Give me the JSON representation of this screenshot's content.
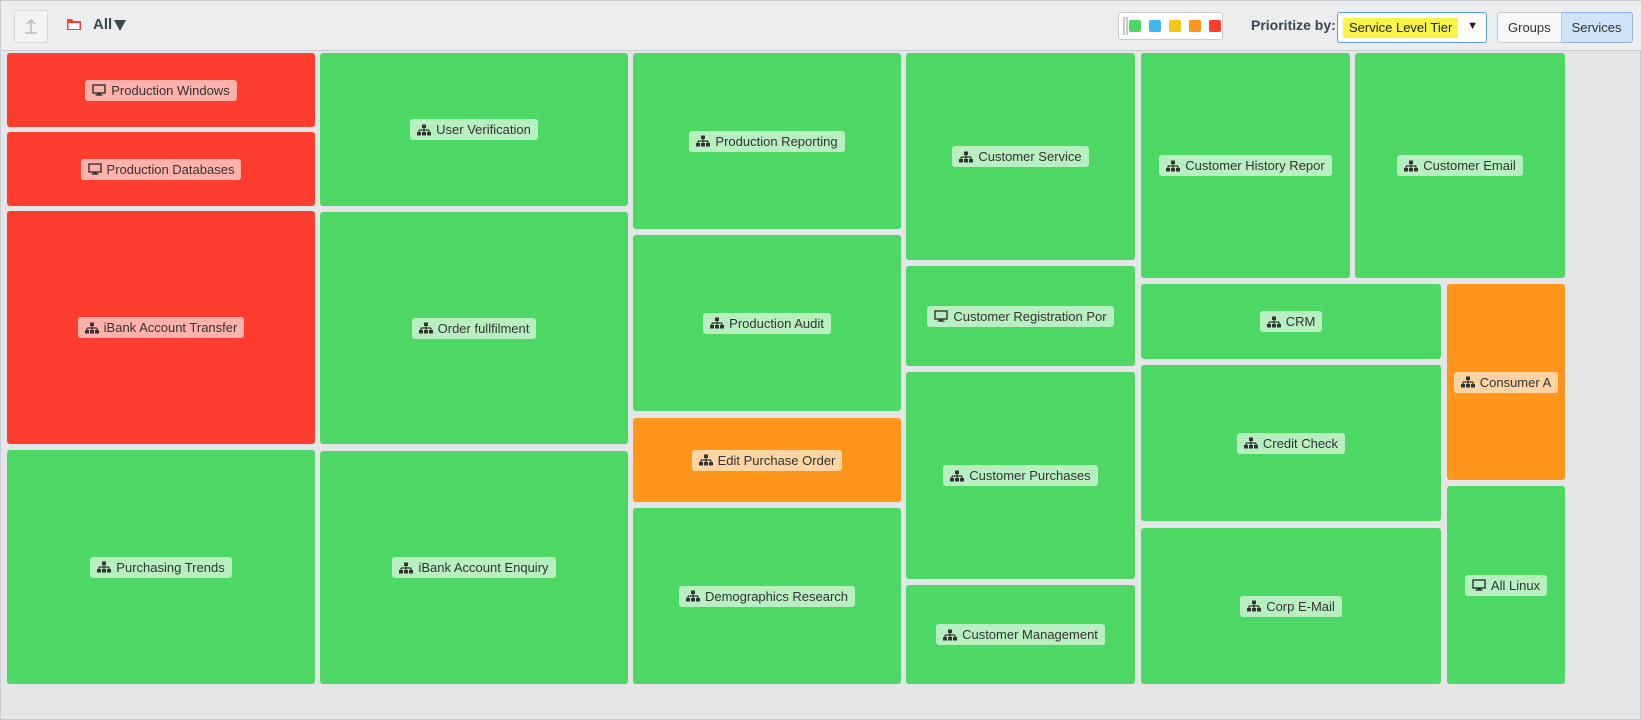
{
  "toolbar": {
    "filter_label": "All",
    "prioritize_label": "Prioritize by:",
    "prioritize_value": "Service Level Tier",
    "groups_label": "Groups",
    "services_label": "Services",
    "legend_colors": [
      "#4dd865",
      "#3fb8f0",
      "#f5c518",
      "#ff951a",
      "#ff3d2f"
    ]
  },
  "tiles": [
    {
      "label": "Production Windows",
      "icon": "monitor-icon",
      "status": "red"
    },
    {
      "label": "Production Databases",
      "icon": "monitor-icon",
      "status": "red"
    },
    {
      "label": "iBank Account Transfer",
      "icon": "service-icon",
      "status": "red"
    },
    {
      "label": "Purchasing Trends",
      "icon": "service-icon",
      "status": "green"
    },
    {
      "label": "User Verification",
      "icon": "service-icon",
      "status": "green"
    },
    {
      "label": "Order fullfilment",
      "icon": "service-icon",
      "status": "green"
    },
    {
      "label": "iBank Account Enquiry",
      "icon": "service-icon",
      "status": "green"
    },
    {
      "label": "Production Reporting",
      "icon": "service-icon",
      "status": "green"
    },
    {
      "label": "Production Audit",
      "icon": "service-icon",
      "status": "green"
    },
    {
      "label": "Edit Purchase Order",
      "icon": "service-icon",
      "status": "orange"
    },
    {
      "label": "Demographics Research",
      "icon": "service-icon",
      "status": "green"
    },
    {
      "label": "Customer Service",
      "icon": "service-icon",
      "status": "green"
    },
    {
      "label": "Customer Registration Por",
      "icon": "monitor-icon",
      "status": "green"
    },
    {
      "label": "Customer Purchases",
      "icon": "service-icon",
      "status": "green"
    },
    {
      "label": "Customer Management",
      "icon": "service-icon",
      "status": "green"
    },
    {
      "label": "Customer History Repor",
      "icon": "service-icon",
      "status": "green"
    },
    {
      "label": "Customer Email",
      "icon": "service-icon",
      "status": "green"
    },
    {
      "label": "CRM",
      "icon": "service-icon",
      "status": "green"
    },
    {
      "label": "Consumer A",
      "icon": "service-icon",
      "status": "orange"
    },
    {
      "label": "Credit Check",
      "icon": "service-icon",
      "status": "green"
    },
    {
      "label": "Corp E-Mail",
      "icon": "service-icon",
      "status": "green"
    },
    {
      "label": "All Linux",
      "icon": "monitor-icon",
      "status": "green"
    }
  ]
}
